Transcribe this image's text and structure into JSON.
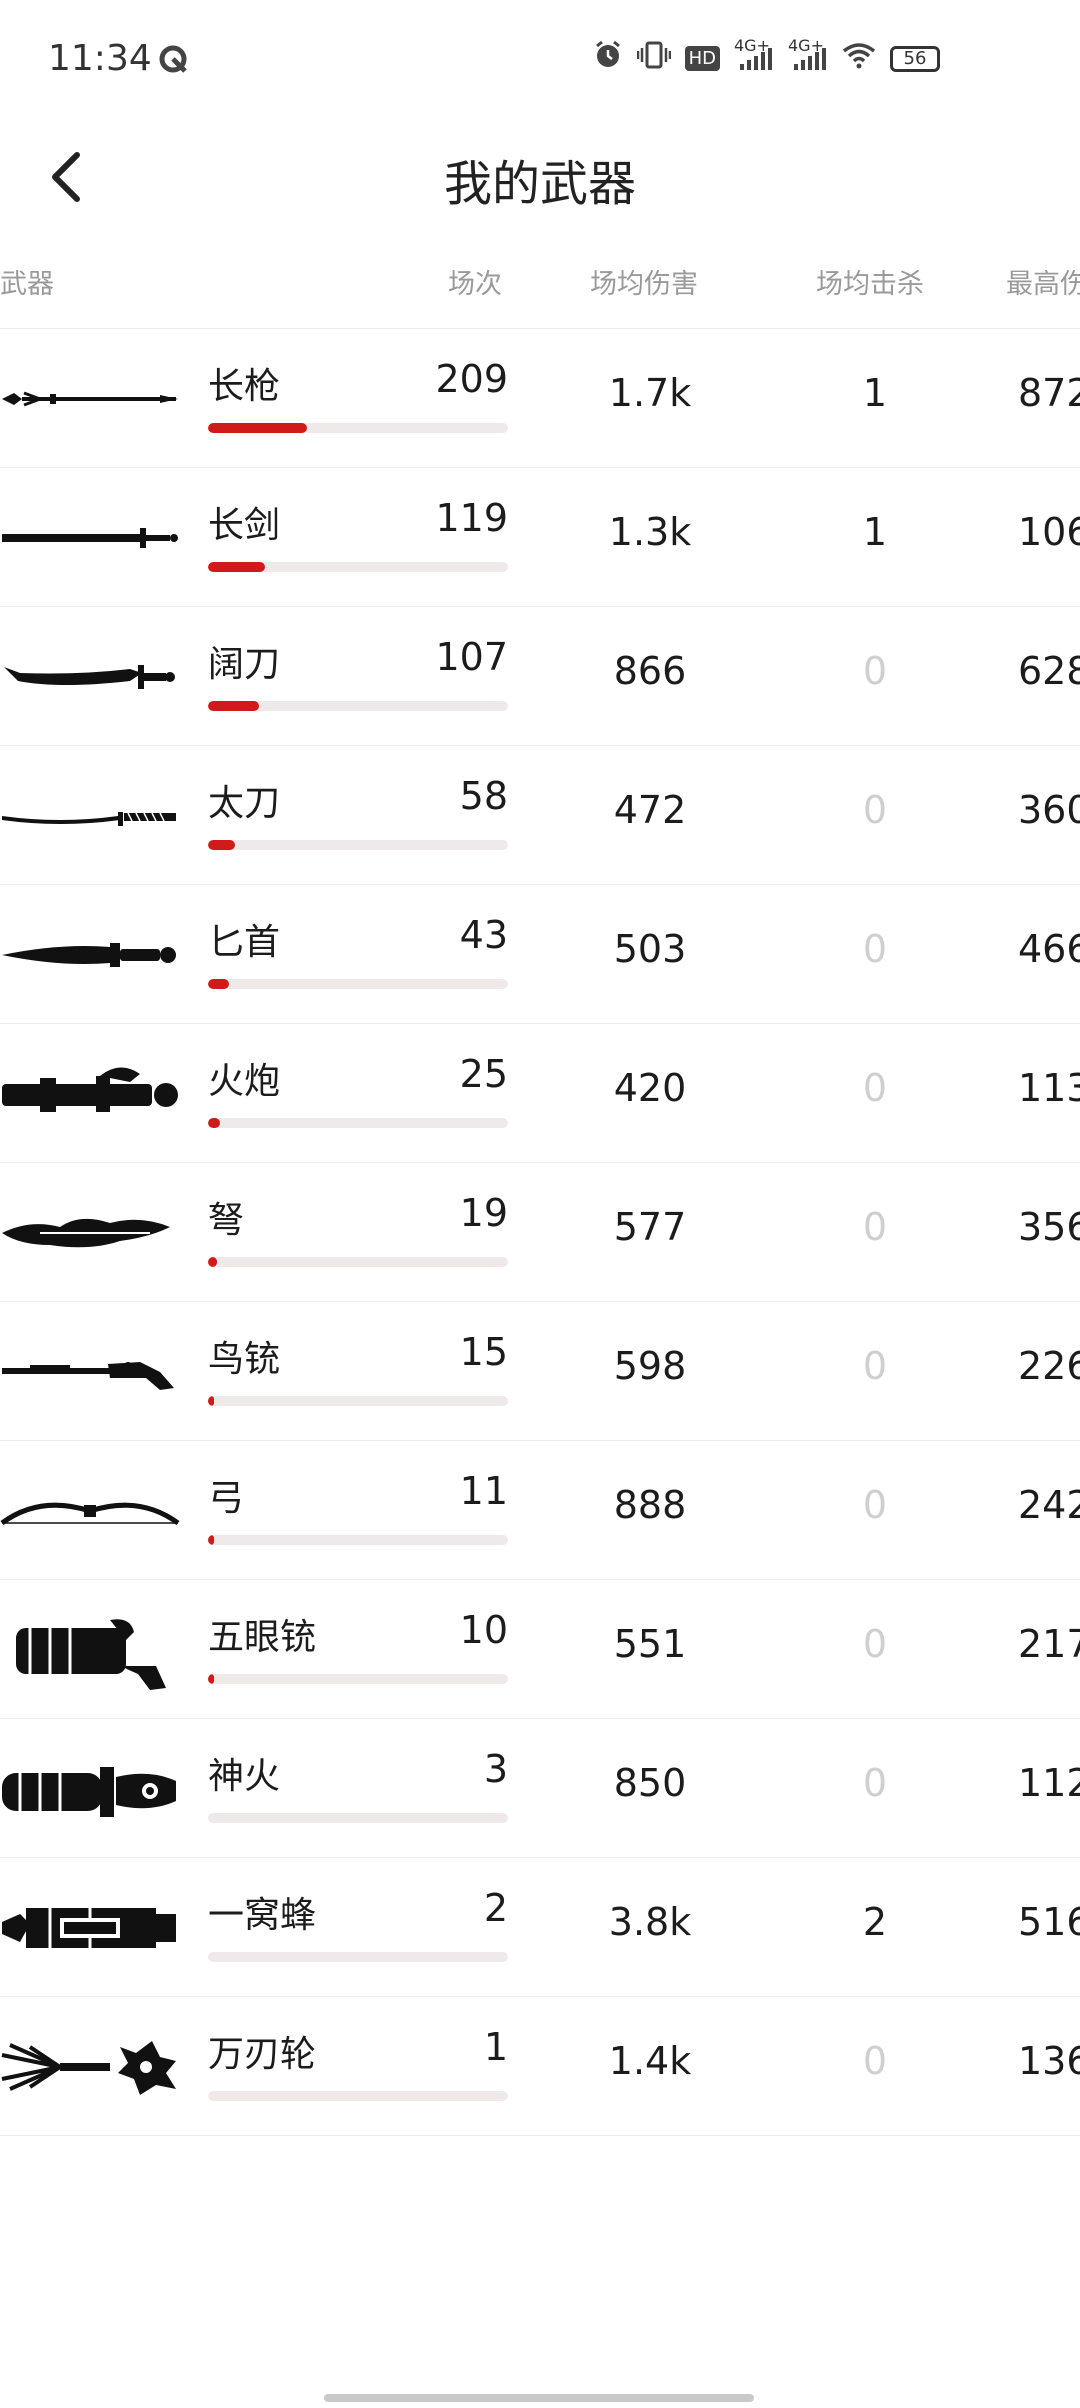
{
  "status_bar": {
    "time": "11:34",
    "hd_label": "HD",
    "net1": "4G+",
    "net2": "4G+",
    "battery": "56"
  },
  "header": {
    "title": "我的武器"
  },
  "columns": {
    "weapon": "武器",
    "matches": "场次",
    "avg_damage": "场均伤害",
    "avg_kills": "场均击杀",
    "max": "最高伤"
  },
  "weapons": [
    {
      "name": "长枪",
      "matches": "209",
      "avg_damage": "1.7k",
      "avg_kills": "1",
      "max": "872",
      "fill": 0.33,
      "icon": "spear-icon"
    },
    {
      "name": "长剑",
      "matches": "119",
      "avg_damage": "1.3k",
      "avg_kills": "1",
      "max": "106",
      "fill": 0.19,
      "icon": "longsword-icon"
    },
    {
      "name": "阔刀",
      "matches": "107",
      "avg_damage": "866",
      "avg_kills": "0",
      "max": "628",
      "fill": 0.17,
      "icon": "broadblade-icon"
    },
    {
      "name": "太刀",
      "matches": "58",
      "avg_damage": "472",
      "avg_kills": "0",
      "max": "360",
      "fill": 0.09,
      "icon": "katana-icon"
    },
    {
      "name": "匕首",
      "matches": "43",
      "avg_damage": "503",
      "avg_kills": "0",
      "max": "466",
      "fill": 0.07,
      "icon": "dagger-icon"
    },
    {
      "name": "火炮",
      "matches": "25",
      "avg_damage": "420",
      "avg_kills": "0",
      "max": "113",
      "fill": 0.04,
      "icon": "cannon-icon"
    },
    {
      "name": "弩",
      "matches": "19",
      "avg_damage": "577",
      "avg_kills": "0",
      "max": "356",
      "fill": 0.03,
      "icon": "crossbow-icon"
    },
    {
      "name": "鸟铳",
      "matches": "15",
      "avg_damage": "598",
      "avg_kills": "0",
      "max": "226",
      "fill": 0.02,
      "icon": "musket-icon"
    },
    {
      "name": "弓",
      "matches": "11",
      "avg_damage": "888",
      "avg_kills": "0",
      "max": "242",
      "fill": 0.02,
      "icon": "bow-icon"
    },
    {
      "name": "五眼铳",
      "matches": "10",
      "avg_damage": "551",
      "avg_kills": "0",
      "max": "217",
      "fill": 0.02,
      "icon": "five-barrel-gun-icon"
    },
    {
      "name": "神火",
      "matches": "3",
      "avg_damage": "850",
      "avg_kills": "0",
      "max": "112",
      "fill": 0.0,
      "icon": "fire-lance-icon"
    },
    {
      "name": "一窝蜂",
      "matches": "2",
      "avg_damage": "3.8k",
      "avg_kills": "2",
      "max": "516",
      "fill": 0.0,
      "icon": "rocket-launcher-icon"
    },
    {
      "name": "万刃轮",
      "matches": "1",
      "avg_damage": "1.4k",
      "avg_kills": "0",
      "max": "136",
      "fill": 0.0,
      "icon": "blade-wheel-icon"
    }
  ],
  "colors": {
    "accent": "#d11a1a",
    "track": "#efe9ea",
    "muted": "#9a9a9a",
    "zero": "#cfcfcf"
  }
}
